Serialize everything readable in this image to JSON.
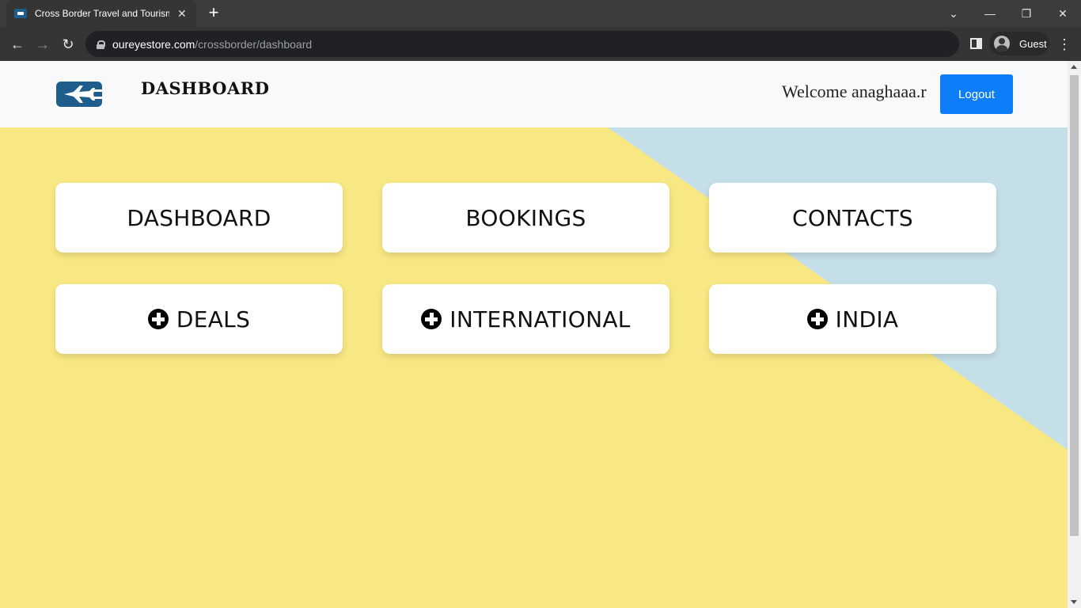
{
  "browser": {
    "tab_title": "Cross Border Travel and Tourism",
    "tab_close": "✕",
    "new_tab": "+",
    "url_host": "oureyestore.com",
    "url_path": "/crossborder/dashboard",
    "profile_label": "Guest",
    "window_controls": {
      "dropdown": "⌄",
      "minimize": "—",
      "restore": "❐",
      "close": "✕"
    },
    "nav": {
      "back": "←",
      "forward": "→",
      "reload": "↻",
      "menu": "⋮"
    }
  },
  "header": {
    "title": "DASHBOARD",
    "welcome": "Welcome anaghaaa.r",
    "logout_label": "Logout",
    "logo_icon": "airplane-logo-icon"
  },
  "cards": [
    {
      "label": "DASHBOARD",
      "icon": ""
    },
    {
      "label": "BOOKINGS",
      "icon": ""
    },
    {
      "label": "CONTACTS",
      "icon": ""
    },
    {
      "label": "DEALS",
      "icon": "plus-circle-icon"
    },
    {
      "label": "INTERNATIONAL",
      "icon": "plus-circle-icon"
    },
    {
      "label": "INDIA",
      "icon": "plus-circle-icon"
    }
  ],
  "colors": {
    "background_yellow": "#f8e883",
    "background_blue": "#c5dfe8",
    "header_bg": "#f8f9fa",
    "logout_button": "#0d7ef8",
    "logo_blue": "#1f5d8c"
  }
}
